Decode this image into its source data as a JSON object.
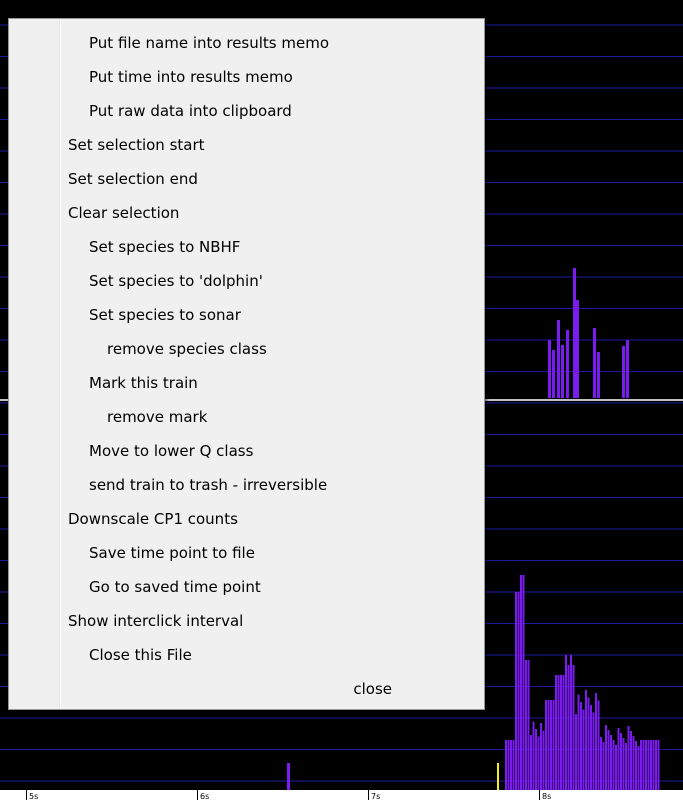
{
  "menu": {
    "items": [
      {
        "label": "Put file name into results memo",
        "indent": 3
      },
      {
        "label": "Put time into results memo",
        "indent": 3
      },
      {
        "label": "Put raw data into clipboard",
        "indent": 3
      },
      {
        "label": "Set selection start",
        "indent": 0
      },
      {
        "label": "Set selection end",
        "indent": 0
      },
      {
        "label": "Clear selection",
        "indent": 0
      },
      {
        "label": "Set species to NBHF",
        "indent": 1
      },
      {
        "label": "Set species to 'dolphin'",
        "indent": 1
      },
      {
        "label": "Set species to sonar",
        "indent": 1
      },
      {
        "label": "remove species class",
        "indent": 2
      },
      {
        "label": "Mark this train",
        "indent": 1
      },
      {
        "label": "remove mark",
        "indent": 2
      },
      {
        "label": "Move to lower Q class",
        "indent": 1
      },
      {
        "label": "send train to trash - irreversible",
        "indent": 1
      },
      {
        "label": "Downscale CP1 counts",
        "indent": 0
      },
      {
        "label": "Save time point to file",
        "indent": 1
      },
      {
        "label": "Go to saved time point",
        "indent": 1
      },
      {
        "label": "Show interclick interval",
        "indent": 0
      },
      {
        "label": "Close this File",
        "indent": 1
      }
    ],
    "close_label": "close"
  },
  "axis": {
    "ticks": [
      "5s",
      "6s",
      "7s",
      "8s"
    ]
  },
  "colors": {
    "background": "#000000",
    "gridline": "#1a1aa0",
    "divider": "#ffffff",
    "bars": "#7a1cf0",
    "marker": "#f0f020",
    "menu_bg": "#f0f0f0"
  }
}
